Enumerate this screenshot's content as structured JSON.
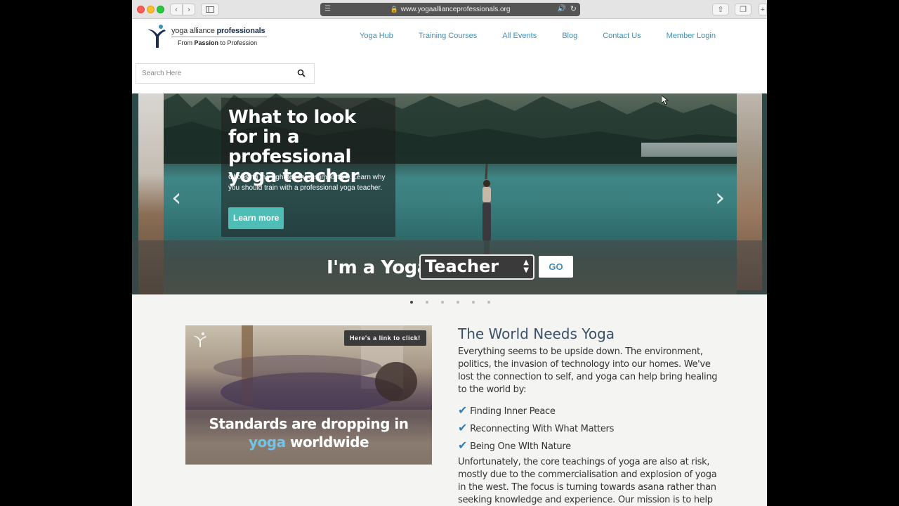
{
  "browser": {
    "url": "www.yogaalliance professionals.org",
    "url_display": "www.yogaallianceprofessionals.org"
  },
  "header": {
    "logo_name_plain": "yoga alliance",
    "logo_name_bold": "professionals",
    "logo_tag_pre": "From",
    "logo_tag_bold": "Passion",
    "logo_tag_post": "to Profession",
    "nav": [
      "Yoga Hub",
      "Training Courses",
      "All Events",
      "Blog",
      "Contact Us",
      "Member Login"
    ]
  },
  "search": {
    "placeholder": "Search Here"
  },
  "hero": {
    "title": "What to look for in a professional yoga teacher",
    "text": "Choosing the right teacher is important. Learn why you should train with a professional yoga teacher.",
    "cta": "Learn more",
    "prev": "‹",
    "next": "›",
    "selector_label": "I'm a Yoga",
    "selector_value": "Teacher",
    "go": "GO",
    "slide_count": 6,
    "active_slide": 1
  },
  "promo": {
    "link_label": "Here's a link to click!",
    "line1": "Standards are dropping in",
    "line2_highlight": "yoga",
    "line2_rest": " worldwide"
  },
  "section": {
    "title": "The World Needs Yoga",
    "intro": "Everything seems to be upside down. The environment, politics, the invasion of technology into our homes. We've lost the connection to self, and yoga can help bring healing to the world by:",
    "checks": [
      "Finding Inner Peace",
      "Reconnecting With What Matters",
      "Being One WIth Nature"
    ],
    "outro": "Unfortunately, the core teachings of yoga are also at risk, mostly due to the commercialisation and explosion of yoga in the west. The focus is turning towards asana rather than seeking knowledge and experience. Our mission is to help"
  },
  "colors": {
    "nav_link": "#3f8fb7",
    "cta": "#4dbdb5",
    "heading": "#3b5169",
    "check": "#2f7fb9"
  }
}
